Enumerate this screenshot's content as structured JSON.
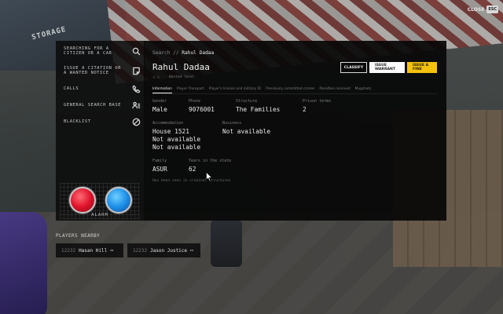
{
  "backdrop": {
    "sign_text": "STORAGE"
  },
  "close": {
    "label": "CLOSE",
    "key": "ESC"
  },
  "sidebar": {
    "items": [
      {
        "label": "SEARCHING FOR A CITIZEN OR A CAR",
        "icon": "search-icon"
      },
      {
        "label": "ISSUE A CITATION OR A WANTED NOTICE",
        "icon": "note-icon"
      },
      {
        "label": "CALLS",
        "icon": "phone-icon"
      },
      {
        "label": "GENERAL SEARCH BASE",
        "icon": "people-icon"
      },
      {
        "label": "BLACKLIST",
        "icon": "blocked-icon"
      }
    ],
    "alarm_label": "ALARM",
    "alarm_colors": {
      "red": "#e0142b",
      "blue": "#1e8fe8"
    }
  },
  "main": {
    "breadcrumb_root": "Search",
    "breadcrumb_sep": "//",
    "breadcrumb_current": "Rahul Dadaa",
    "name": "Rahul Dadaa",
    "stars": "☆☆",
    "wanted_level": "Wanted level",
    "actions": {
      "classify": "CLASSIFY",
      "warrant": "ISSUE WARRANT",
      "fine": "ISSUE A FINE"
    },
    "action_colors": {
      "fine": "#f4c20d"
    },
    "tabs": [
      "Information",
      "Player Transport",
      "Player's license and military ID",
      "Previously committed crimes",
      "Penalties received",
      "Mugshots"
    ],
    "fields": {
      "gender": {
        "label": "Gender",
        "value": "Male"
      },
      "phone": {
        "label": "Phone",
        "value": "9076001"
      },
      "structure": {
        "label": "Structure",
        "value": "The Families"
      },
      "prison": {
        "label": "Prison terms",
        "value": "2"
      },
      "accommodation": {
        "label": "Accommodation",
        "values": [
          "House 1521",
          "Not available",
          "Not available"
        ]
      },
      "business": {
        "label": "Business",
        "value": "Not available"
      },
      "family": {
        "label": "Family",
        "value": "ASUR"
      },
      "years": {
        "label": "Years in the state",
        "value": "62"
      }
    },
    "note": "Has been seen in criminal structures"
  },
  "nearby": {
    "title": "PLAYERS NEARBY",
    "players": [
      {
        "id": "12232",
        "name": "Hasan Hill",
        "more": "⋯"
      },
      {
        "id": "12232",
        "name": "Jason Justice",
        "more": "⋯"
      }
    ]
  }
}
